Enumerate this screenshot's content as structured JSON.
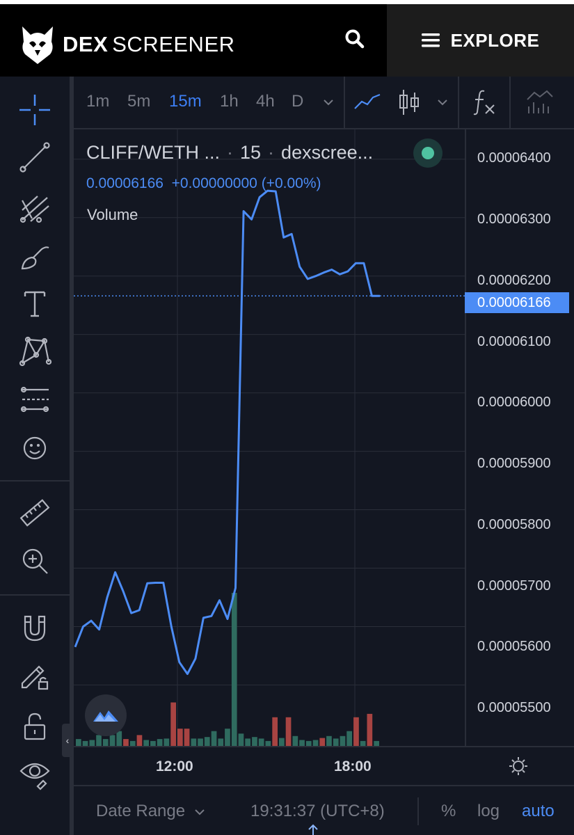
{
  "header": {
    "brand_bold": "DEX",
    "brand_light": "SCREENER",
    "explore_label": "EXPLORE"
  },
  "toolbar": {
    "timeframes": [
      "1m",
      "5m",
      "15m",
      "1h",
      "4h",
      "D"
    ],
    "active_timeframe": "15m"
  },
  "legend": {
    "pair": "CLIFF/WETH ...",
    "interval": "15",
    "source": "dexscree...",
    "price": "0.00006166",
    "change": "+0.00000000",
    "change_pct": "(+0.00%)",
    "volume_label": "Volume"
  },
  "price_axis": {
    "labels": [
      "0.00006400",
      "0.00006300",
      "0.00006200",
      "0.00006100",
      "0.00006000",
      "0.00005900",
      "0.00005800",
      "0.00005700",
      "0.00005600",
      "0.00005500"
    ],
    "current_price": "0.00006166"
  },
  "time_axis": {
    "labels": [
      "12:00",
      "18:00"
    ]
  },
  "bottom_bar": {
    "date_range": "Date Range",
    "clock": "19:31:37 (UTC+8)",
    "percent": "%",
    "log": "log",
    "auto": "auto"
  },
  "colors": {
    "line": "#4c8cf5",
    "volume_up": "#2f6b5f",
    "volume_down": "#a84442",
    "background": "#131722"
  },
  "chart_data": {
    "type": "line",
    "series": [
      {
        "values": [
          5.565e-05,
          5.6e-05,
          5.61e-05,
          5.595e-05,
          5.65e-05,
          5.693e-05,
          5.66e-05,
          5.623e-05,
          5.628e-05,
          5.674e-05,
          5.675e-05,
          5.675e-05,
          5.6e-05,
          5.539e-05,
          5.519e-05,
          5.545e-05,
          5.615e-05,
          5.618e-05,
          5.645e-05,
          5.613e-05,
          5.666e-05,
          6.311e-05,
          6.297e-05,
          6.335e-05,
          6.346e-05,
          6.345e-05,
          6.266e-05,
          6.272e-05,
          6.216e-05,
          6.195e-05,
          6.2e-05,
          6.206e-05,
          6.211e-05,
          6.203e-05,
          6.208e-05,
          6.222e-05,
          6.222e-05,
          6.166e-05,
          6.166e-05
        ]
      }
    ],
    "volume": [
      {
        "v": 1.4,
        "up": true
      },
      {
        "v": 1.0,
        "up": true
      },
      {
        "v": 1.2,
        "up": true
      },
      {
        "v": 2.2,
        "up": true
      },
      {
        "v": 1.4,
        "up": true
      },
      {
        "v": 2.2,
        "up": true
      },
      {
        "v": 3.0,
        "up": true
      },
      {
        "v": 1.4,
        "up": false
      },
      {
        "v": 1.0,
        "up": true
      },
      {
        "v": 2.2,
        "up": false
      },
      {
        "v": 1.2,
        "up": true
      },
      {
        "v": 1.0,
        "up": true
      },
      {
        "v": 1.4,
        "up": true
      },
      {
        "v": 1.5,
        "up": true
      },
      {
        "v": 8.8,
        "up": false
      },
      {
        "v": 3.5,
        "up": false
      },
      {
        "v": 3.5,
        "up": false
      },
      {
        "v": 1.5,
        "up": true
      },
      {
        "v": 1.5,
        "up": true
      },
      {
        "v": 1.8,
        "up": true
      },
      {
        "v": 3.0,
        "up": true
      },
      {
        "v": 1.5,
        "up": true
      },
      {
        "v": 3.5,
        "up": true
      },
      {
        "v": 31.0,
        "up": true
      },
      {
        "v": 2.5,
        "up": true
      },
      {
        "v": 1.5,
        "up": true
      },
      {
        "v": 1.8,
        "up": true
      },
      {
        "v": 1.5,
        "up": true
      },
      {
        "v": 1.0,
        "up": true
      },
      {
        "v": 5.8,
        "up": false
      },
      {
        "v": 1.6,
        "up": true
      },
      {
        "v": 5.8,
        "up": false
      },
      {
        "v": 2.0,
        "up": true
      },
      {
        "v": 1.2,
        "up": true
      },
      {
        "v": 1.0,
        "up": true
      },
      {
        "v": 1.2,
        "up": true
      },
      {
        "v": 1.6,
        "up": false
      },
      {
        "v": 2.0,
        "up": true
      },
      {
        "v": 1.5,
        "up": true
      },
      {
        "v": 2.0,
        "up": true
      },
      {
        "v": 3.0,
        "up": true
      },
      {
        "v": 5.8,
        "up": false
      },
      {
        "v": 1.0,
        "up": true
      },
      {
        "v": 6.5,
        "up": false
      },
      {
        "v": 1.0,
        "up": true
      }
    ],
    "ylim": [
      5.46e-05,
      6.42e-05
    ],
    "xlabel": "",
    "ylabel": "",
    "grid": true
  }
}
